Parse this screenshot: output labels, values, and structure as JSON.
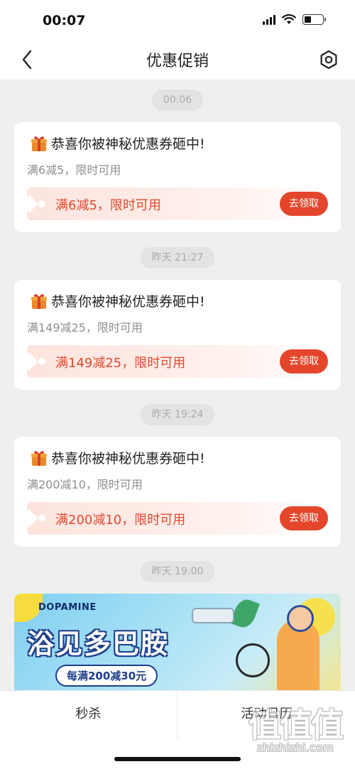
{
  "status_bar": {
    "time": "00:07"
  },
  "nav": {
    "title": "优惠促销",
    "back_icon": "chevron-left-icon",
    "settings_icon": "hexagon-settings-icon"
  },
  "feed": [
    {
      "timestamp": "00:06",
      "title": "恭喜你被神秘优惠券砸中!",
      "subtitle": "满6减5，限时可用",
      "coupon_text": "满6减5，限时可用",
      "button": "去领取"
    },
    {
      "timestamp": "昨天 21:27",
      "title": "恭喜你被神秘优惠券砸中!",
      "subtitle": "满149减25，限时可用",
      "coupon_text": "满149减25，限时可用",
      "button": "去领取"
    },
    {
      "timestamp": "昨天 19:24",
      "title": "恭喜你被神秘优惠券砸中!",
      "subtitle": "满200减10，限时可用",
      "coupon_text": "满200减10，限时可用",
      "button": "去领取"
    }
  ],
  "banner": {
    "timestamp": "昨天 19:00",
    "brand": "DOPAMINE",
    "headline": "浴见多巴胺",
    "promo": "每满200减30元"
  },
  "tabs": [
    {
      "label": "秒杀"
    },
    {
      "label": "活动日历"
    }
  ],
  "watermark": {
    "glyphs": "值值值",
    "text": "zhizhizhi.com"
  },
  "colors": {
    "accent": "#e4462c",
    "coupon_text": "#e04a2e",
    "background": "#efefef"
  }
}
